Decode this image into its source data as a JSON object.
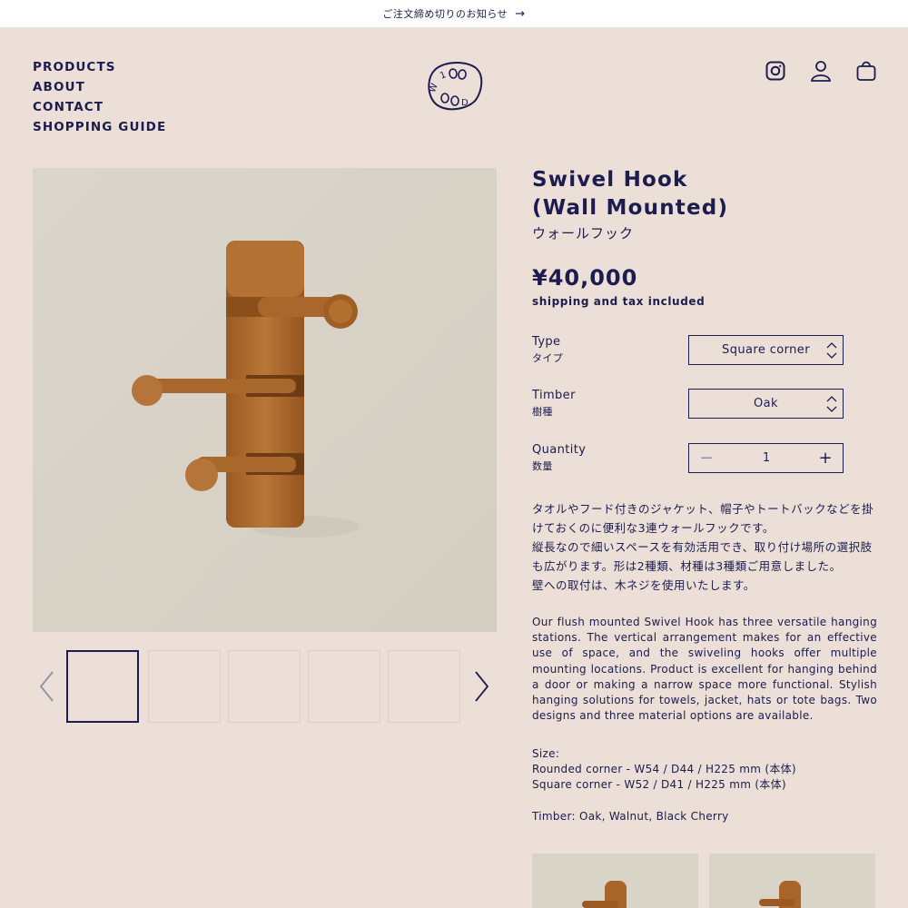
{
  "announcement": {
    "text": "ご注文締め切りのお知らせ",
    "arrow": "→"
  },
  "nav": {
    "items": [
      "PRODUCTS",
      "ABOUT",
      "CONTACT",
      "SHOPPING GUIDE"
    ]
  },
  "brand": {
    "logo_text": "100 WOOD"
  },
  "header_icons": [
    "instagram-icon",
    "account-icon",
    "cart-icon"
  ],
  "product": {
    "title_line1": "Swivel Hook",
    "title_line2": "(Wall Mounted)",
    "title_jp": "ウォールフック",
    "price": "¥40,000",
    "price_note": "shipping and tax included"
  },
  "options": {
    "type": {
      "label": "Type",
      "label_jp": "タイプ",
      "value": "Square corner"
    },
    "timber": {
      "label": "Timber",
      "label_jp": "樹種",
      "value": "Oak"
    },
    "quantity": {
      "label": "Quantity",
      "label_jp": "数量",
      "value": "1",
      "minus": "−",
      "plus": "+"
    }
  },
  "description_jp": [
    "タオルやフード付きのジャケット、帽子やトートバックなどを掛",
    "けておくのに便利な3連ウォールフックです。",
    "縦長なので細いスペースを有効活用でき、取り付け場所の選択肢",
    "も広がります。形は2種類、材種は3種類ご用意しました。",
    "壁への取付は、木ネジを使用いたします。"
  ],
  "description_en": "Our flush mounted Swivel Hook has three versatile hanging stations. The vertical arrangement makes for an effective use of space, and the swiveling hooks offer multiple mounting locations. Product is excellent for hanging behind a door or making a narrow space more functional. Stylish hanging solutions for towels, jacket, hats or tote bags. Two designs and three material options are available.",
  "specs": {
    "size_label": "Size:",
    "size_rounded": "Rounded corner - W54 / D44 / H225 mm (本体)",
    "size_square": "Square corner  - W52 / D41 / H225 mm (本体)",
    "timber": "Timber: Oak, Walnut, Black Cherry"
  },
  "colors": {
    "background": "#ebdfd7",
    "navy": "#1c1c4e",
    "wood": "#a8652a"
  }
}
